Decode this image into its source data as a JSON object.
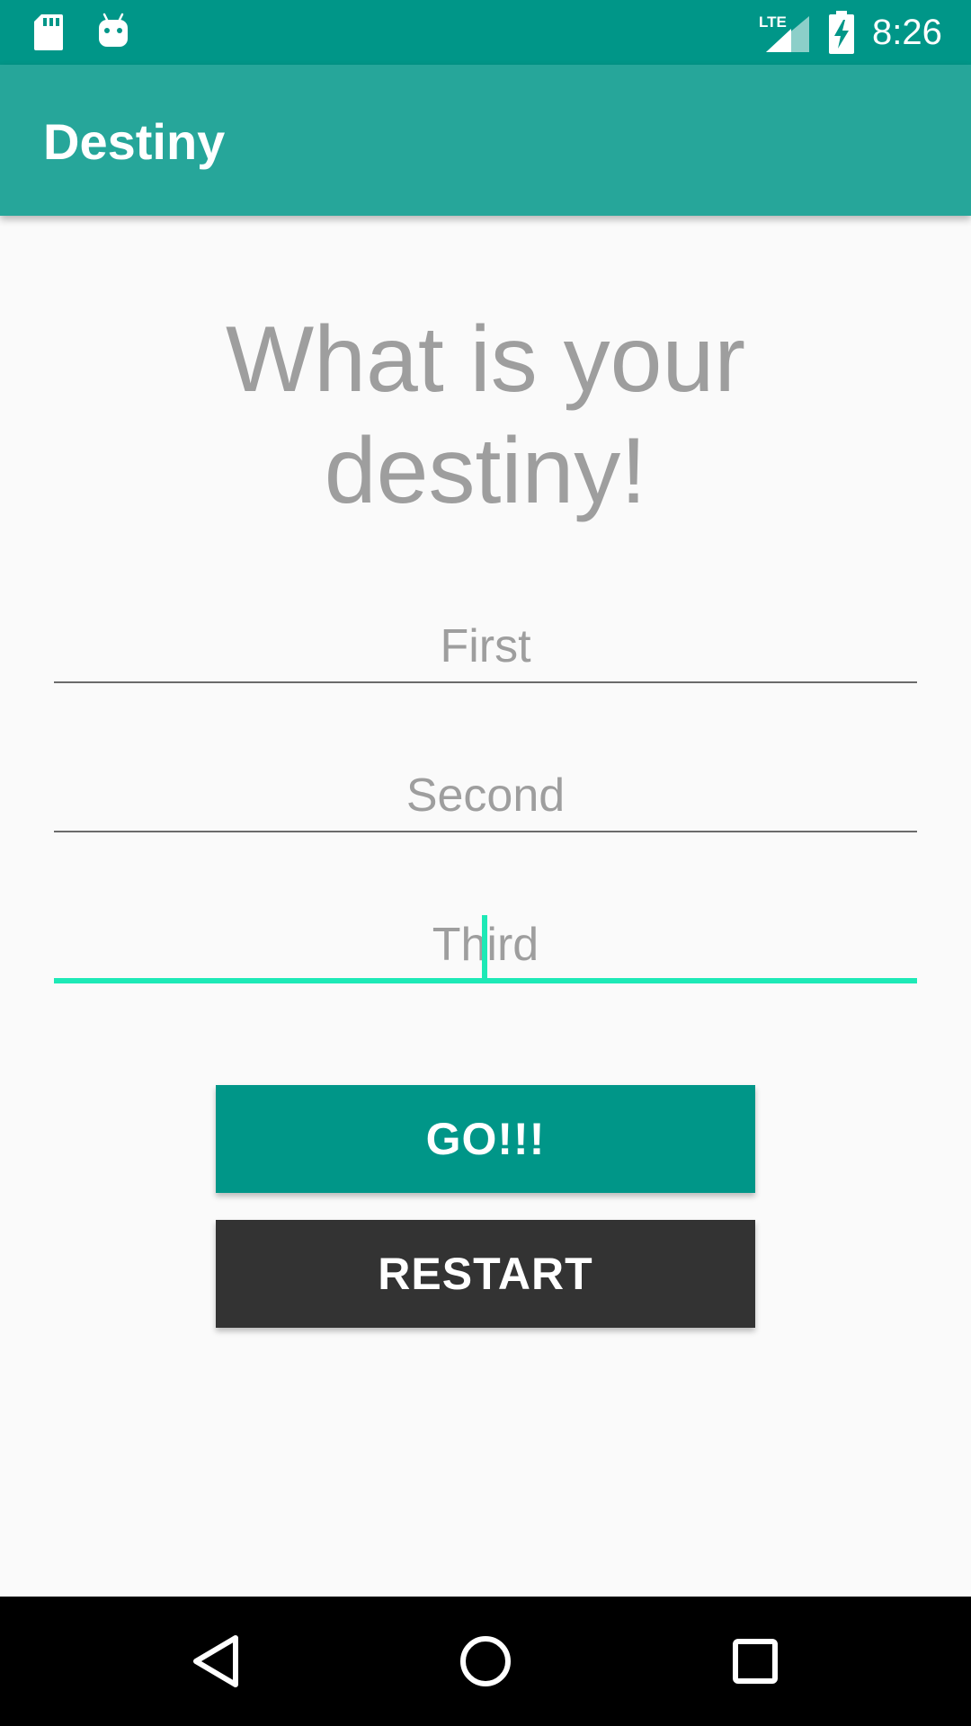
{
  "status_bar": {
    "time": "8:26",
    "icons": [
      "sd-card-icon",
      "android-icon",
      "lte-signal-icon",
      "battery-charging-icon"
    ],
    "network_label": "LTE"
  },
  "app_bar": {
    "title": "Destiny"
  },
  "main": {
    "heading": "What is your destiny!",
    "fields": [
      {
        "placeholder": "First",
        "value": ""
      },
      {
        "placeholder": "Second",
        "value": ""
      },
      {
        "placeholder": "Third",
        "value": ""
      }
    ],
    "go_label": "GO!!!",
    "restart_label": "RESTART"
  },
  "nav_bar": {
    "icons": [
      "back-icon",
      "home-icon",
      "recents-icon"
    ]
  },
  "colors": {
    "status_bar": "#009688",
    "app_bar": "#26a69a",
    "accent": "#1de9b6",
    "go_button": "#009688",
    "restart_button": "#333333",
    "heading_text": "#9e9e9e"
  }
}
